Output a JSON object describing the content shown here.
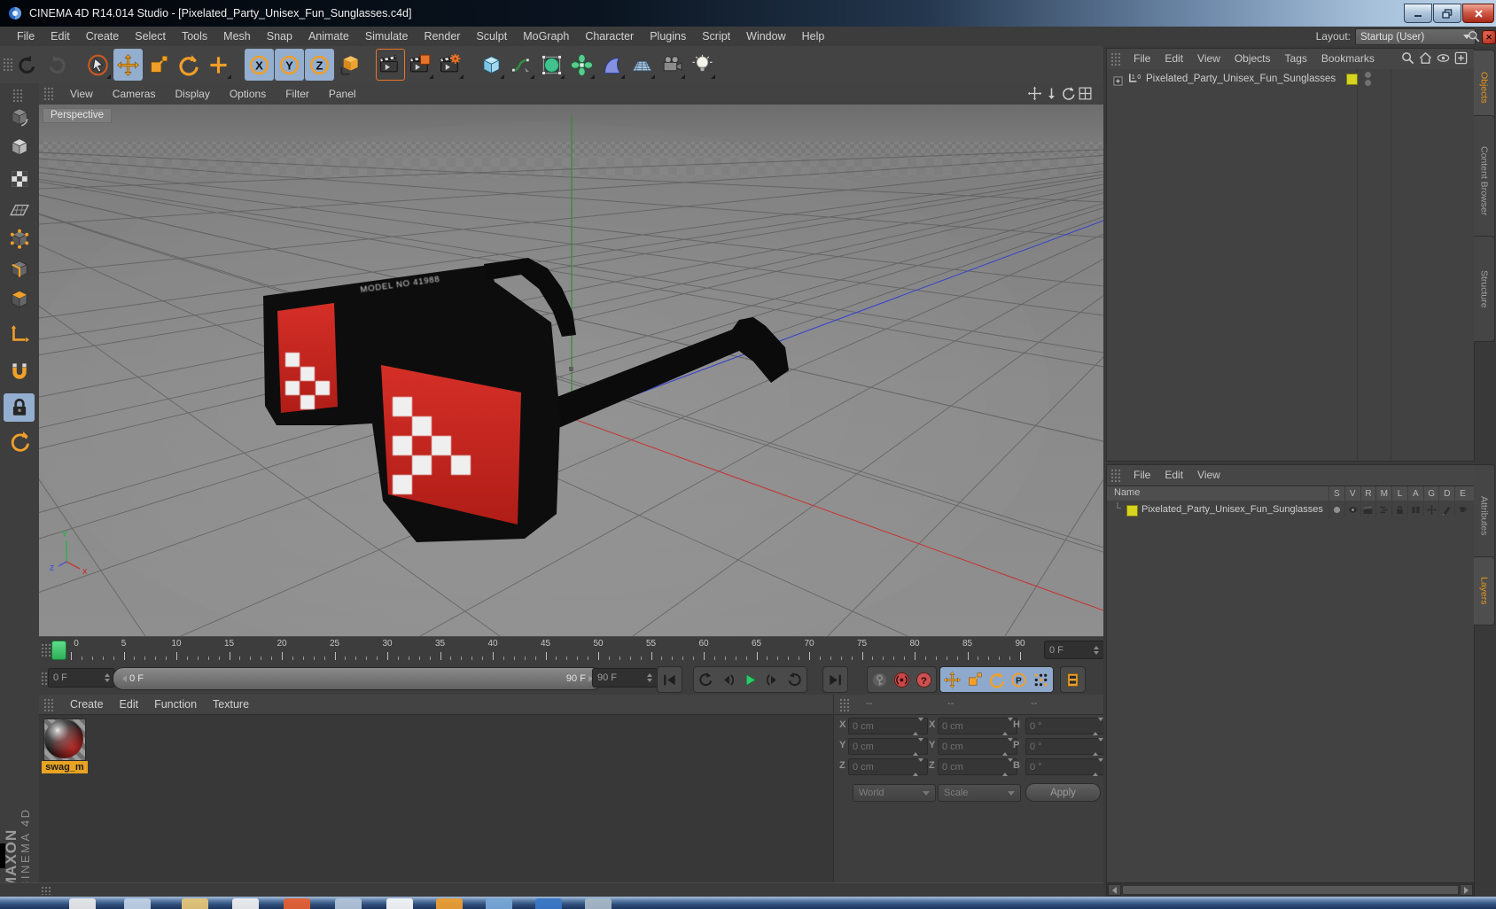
{
  "window": {
    "title": "CINEMA 4D R14.014 Studio - [Pixelated_Party_Unisex_Fun_Sunglasses.c4d]",
    "buttons": [
      "minimize-button",
      "restore-button",
      "close-button"
    ]
  },
  "menubar": {
    "items": [
      "File",
      "Edit",
      "Create",
      "Select",
      "Tools",
      "Mesh",
      "Snap",
      "Animate",
      "Simulate",
      "Render",
      "Sculpt",
      "MoGraph",
      "Character",
      "Plugins",
      "Script",
      "Window",
      "Help"
    ],
    "layout_label": "Layout:",
    "layout_value": "Startup (User)"
  },
  "toolbar": {
    "items": [
      {
        "name": "undo-button",
        "icon": "undo-icon"
      },
      {
        "name": "redo-button",
        "icon": "redo-icon",
        "disabled": true
      },
      {
        "sep": true
      },
      {
        "name": "live-selection-button",
        "icon": "live-selection-icon",
        "more": true
      },
      {
        "name": "move-button",
        "icon": "move-icon",
        "active": true
      },
      {
        "name": "scale-button",
        "icon": "scale-icon"
      },
      {
        "name": "rotate-button",
        "icon": "rotate-icon"
      },
      {
        "name": "last-tool-button",
        "icon": "last-tool-icon",
        "more": true
      },
      {
        "sep": true
      },
      {
        "name": "lock-x-button",
        "icon": "axis-x-icon",
        "active": true
      },
      {
        "name": "lock-y-button",
        "icon": "axis-y-icon",
        "active": true
      },
      {
        "name": "lock-z-button",
        "icon": "axis-z-icon",
        "active": true
      },
      {
        "name": "coordinate-system-button",
        "icon": "coord-system-icon"
      },
      {
        "sep": true
      },
      {
        "name": "render-view-button",
        "icon": "render-view-icon",
        "framed": true
      },
      {
        "name": "render-picture-viewer-button",
        "icon": "render-picture-icon",
        "more": true
      },
      {
        "name": "render-settings-button",
        "icon": "render-settings-icon",
        "more": true
      },
      {
        "sep": true
      },
      {
        "name": "add-cube-button",
        "icon": "cube-icon",
        "more": true
      },
      {
        "name": "add-spline-button",
        "icon": "spline-icon",
        "more": true
      },
      {
        "name": "add-subdivision-button",
        "icon": "subdivision-icon",
        "more": true
      },
      {
        "name": "add-mograph-button",
        "icon": "mograph-icon",
        "more": true
      },
      {
        "name": "add-deformer-button",
        "icon": "deformer-icon",
        "more": true
      },
      {
        "name": "add-floor-button",
        "icon": "floor-icon",
        "more": true
      },
      {
        "name": "add-camera-button",
        "icon": "camera-icon",
        "more": true
      },
      {
        "name": "add-light-button",
        "icon": "light-icon",
        "more": true
      }
    ]
  },
  "left_toolbar": {
    "items": [
      {
        "name": "make-editable-button",
        "icon": "convert-icon"
      },
      {
        "name": "model-mode-button",
        "icon": "model-mode-icon"
      },
      {
        "name": "texture-mode-button",
        "icon": "texture-mode-icon"
      },
      {
        "name": "workplane-mode-button",
        "icon": "workplane-icon"
      },
      {
        "name": "points-mode-button",
        "icon": "points-mode-icon"
      },
      {
        "name": "edges-mode-button",
        "icon": "edges-mode-icon"
      },
      {
        "name": "polygons-mode-button",
        "icon": "polygons-mode-icon"
      },
      {
        "name": "enable-axis-button",
        "icon": "axis-mode-icon"
      },
      {
        "name": "snap-magnet-button",
        "icon": "magnet-icon"
      },
      {
        "name": "lock-workplane-button",
        "icon": "lock-icon",
        "active": true
      },
      {
        "name": "snapping-button",
        "icon": "snap-ring-icon"
      }
    ]
  },
  "viewport": {
    "menu": [
      "View",
      "Cameras",
      "Display",
      "Options",
      "Filter",
      "Panel"
    ],
    "controls": [
      "pan-view-icon",
      "zoom-view-icon",
      "rotate-view-icon",
      "toggle-view-icon"
    ],
    "view_label": "Perspective",
    "model_text": "MODEL NO 41988",
    "axis": {
      "x": "X",
      "y": "Y",
      "z": "Z"
    }
  },
  "timeline": {
    "start": 0,
    "end": 90,
    "step": 5,
    "marker_frame": 0,
    "frame_spinner": "0 F",
    "range_start": "0 F",
    "range_end": "90 F",
    "end_spinner": "90 F"
  },
  "transport": {
    "groups": [
      [
        "goto-start-icon"
      ],
      [
        "play-backwards-icon",
        "previous-frame-icon",
        "play-forwards-icon",
        "next-frame-icon",
        "loop-icon"
      ],
      [
        "goto-end-icon"
      ],
      [
        "record-disabled-icon",
        "record-keyframe-icon",
        "autokeying-icon"
      ],
      [
        "keyframe-position-icon",
        "keyframe-scale-icon",
        "keyframe-rotation-icon",
        "keyframe-parameter-icon",
        "keyframe-points-icon"
      ],
      [
        "keyframe-selection-icon"
      ]
    ],
    "blue_group": 4
  },
  "materials": {
    "menu": [
      "Create",
      "Edit",
      "Function",
      "Texture"
    ],
    "items": [
      {
        "name": "swag_m"
      }
    ]
  },
  "coordinates": {
    "headers": [
      "--",
      "--",
      "--"
    ],
    "rows": [
      {
        "l1": "X",
        "v1": "0 cm",
        "l2": "X",
        "v2": "0 cm",
        "l3": "H",
        "v3": "0 °"
      },
      {
        "l1": "Y",
        "v1": "0 cm",
        "l2": "Y",
        "v2": "0 cm",
        "l3": "P",
        "v3": "0 °"
      },
      {
        "l1": "Z",
        "v1": "0 cm",
        "l2": "Z",
        "v2": "0 cm",
        "l3": "B",
        "v3": "0 °"
      }
    ],
    "mode1": "World",
    "mode2": "Scale",
    "apply": "Apply"
  },
  "object_manager": {
    "menu": [
      "File",
      "Edit",
      "View",
      "Objects",
      "Tags",
      "Bookmarks"
    ],
    "icons": [
      "search-icon",
      "home-icon",
      "eye-icon",
      "add-panel-icon"
    ],
    "object_name": "Pixelated_Party_Unisex_Fun_Sunglasses"
  },
  "layer_panel": {
    "menu": [
      "File",
      "Edit",
      "View"
    ],
    "name_header": "Name",
    "columns": [
      "S",
      "V",
      "R",
      "M",
      "L",
      "A",
      "G",
      "D",
      "E"
    ],
    "row_icons": [
      "solo-icon",
      "visibility-eye-icon",
      "render-visibility-icon",
      "manager-icon",
      "lock-small-icon",
      "animation-icon",
      "generators-icon",
      "deformers-icon",
      "expressions-icon"
    ],
    "object_name": "Pixelated_Party_Unisex_Fun_Sunglasses"
  },
  "right_tabs": [
    {
      "label": "Objects",
      "active": true
    },
    {
      "label": "Content Browser",
      "active": false
    },
    {
      "label": "Structure",
      "active": false
    },
    {
      "label": "Attributes",
      "active": false
    },
    {
      "label": "Layers",
      "active": true
    }
  ],
  "branding": {
    "maxon": "MAXON",
    "cinema": "CINEMA 4D"
  },
  "colors": {
    "accent_orange": "#f09f28",
    "highlight_blue": "#93aecf",
    "record_red": "#c94848",
    "marker_green": "#3fd473",
    "lens_red": "#cc2420",
    "chip_yellow": "#d6d41e"
  }
}
